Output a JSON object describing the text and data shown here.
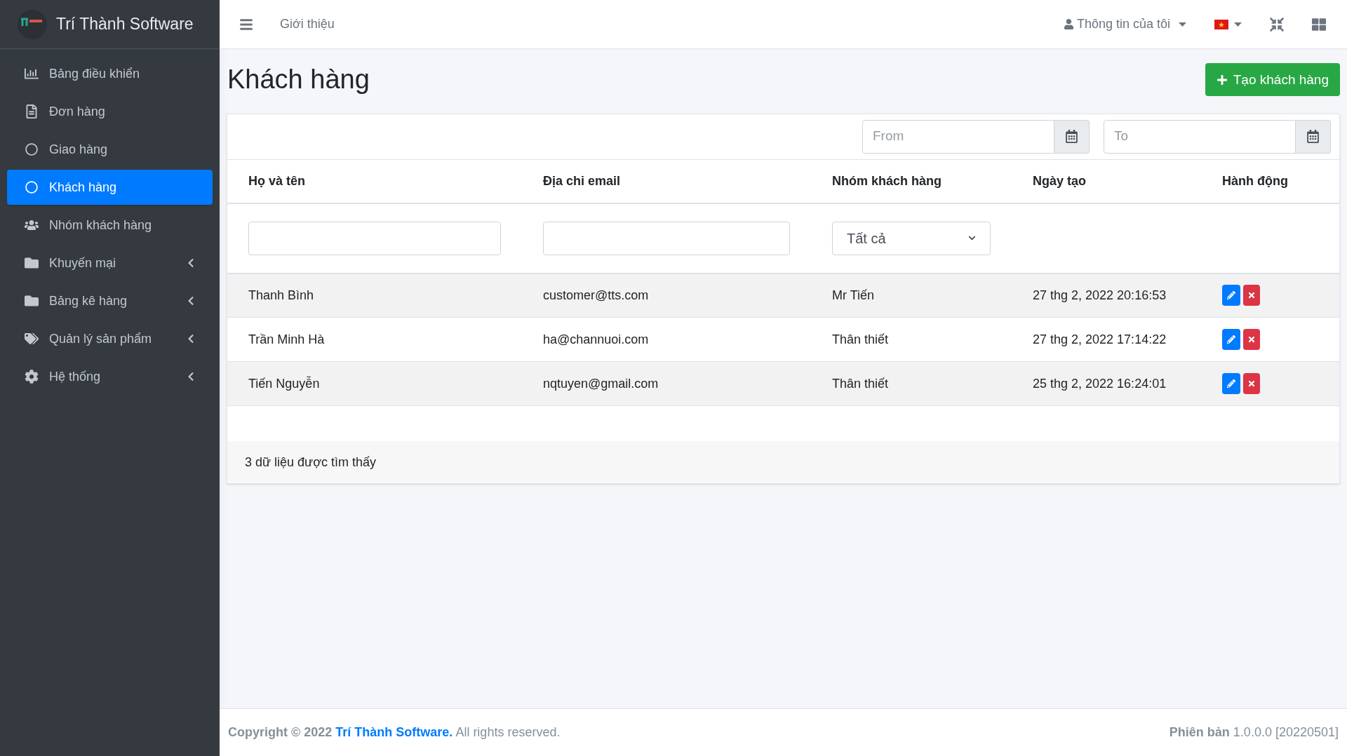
{
  "brand": {
    "name": "Trí Thành Software"
  },
  "sidebar": {
    "items": [
      {
        "label": "Bảng điều khiển",
        "selected": false,
        "kind": "link"
      },
      {
        "label": "Đơn hàng",
        "selected": false,
        "kind": "link"
      },
      {
        "label": "Giao hàng",
        "selected": false,
        "kind": "link"
      },
      {
        "label": "Khách hàng",
        "selected": true,
        "kind": "link"
      },
      {
        "label": "Nhóm khách hàng",
        "selected": false,
        "kind": "link"
      },
      {
        "label": "Khuyến mại",
        "selected": false,
        "kind": "group",
        "expanded": false
      },
      {
        "label": "Bảng kê hàng",
        "selected": false,
        "kind": "group",
        "expanded": false
      },
      {
        "label": "Quản lý sản phẩm",
        "selected": false,
        "kind": "group",
        "expanded": false
      },
      {
        "label": "Hệ thống",
        "selected": false,
        "kind": "group",
        "expanded": false
      }
    ]
  },
  "topbar": {
    "nav_link": "Giới thiệu",
    "user_menu": "Thông tin của tôi"
  },
  "page": {
    "title": "Khách hàng",
    "create_button": "Tạo khách hàng"
  },
  "date_filter": {
    "from": {
      "placeholder": "From"
    },
    "to": {
      "placeholder": "To"
    }
  },
  "table": {
    "columns": [
      "Họ và tên",
      "Địa chỉ email",
      "Nhóm khách hàng",
      "Ngày tạo",
      "Hành động"
    ],
    "group_filter": "Tất cả",
    "rows": [
      {
        "name": "Thanh Bình",
        "email": "customer@tts.com",
        "group": "Mr Tiến",
        "created": "27 thg 2, 2022 20:16:53"
      },
      {
        "name": "Trần Minh Hà",
        "email": "ha@channuoi.com",
        "group": "Thân thiết",
        "created": "27 thg 2, 2022 17:14:22"
      },
      {
        "name": "Tiến Nguyễn",
        "email": "nqtuyen@gmail.com",
        "group": "Thân thiết",
        "created": "25 thg 2, 2022 16:24:01"
      }
    ],
    "summary": "3 dữ liệu được tìm thấy"
  },
  "footer": {
    "copyright_prefix": "Copyright © 2022",
    "company_link": "Trí Thành Software.",
    "copyright_suffix": "All rights reserved.",
    "version": "**Phiên bản** 1.0.0.0 [20220501]"
  }
}
